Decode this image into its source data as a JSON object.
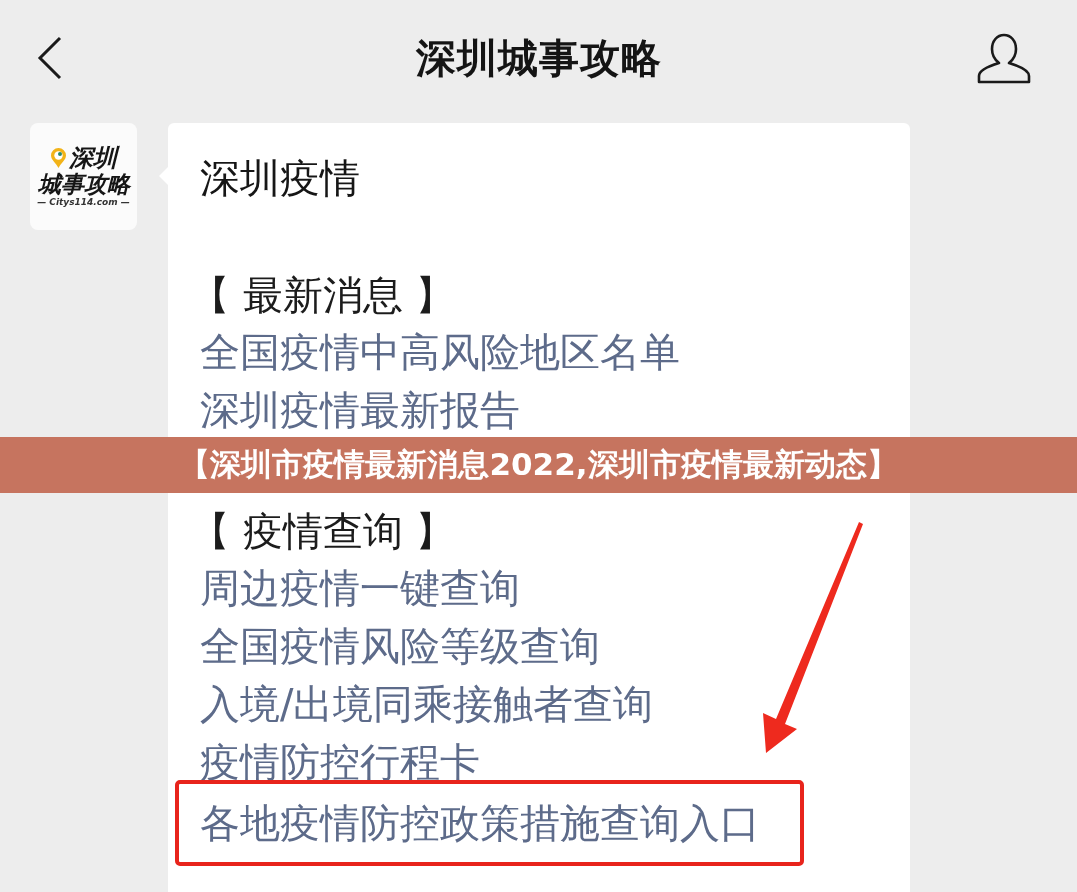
{
  "nav_bar": {
    "title": "深圳城事攻略"
  },
  "chat": {
    "sender_logo": {
      "line_1": "深圳",
      "line_2": "城事攻略",
      "site": "— Citys114.com —"
    },
    "message": {
      "heading": "深圳疫情",
      "sections": [
        {
          "title": "【 最新消息 】",
          "links": [
            {
              "text": "全国疫情中高风险地区名单",
              "highlighted": false
            },
            {
              "text": "深圳疫情最新报告",
              "highlighted": false
            }
          ]
        },
        {
          "title": "【 疫情查询 】",
          "links": [
            {
              "text": "周边疫情一键查询",
              "highlighted": false
            },
            {
              "text": "全国疫情风险等级查询",
              "highlighted": false
            },
            {
              "text": "入境/出境同乘接触者查询",
              "highlighted": false
            },
            {
              "text": "疫情防控行程卡",
              "highlighted": false
            },
            {
              "text": "各地疫情防控政策措施查询入口",
              "highlighted": true
            }
          ]
        }
      ]
    }
  },
  "banner": {
    "text": "【深圳市疫情最新消息2022,深圳市疫情最新动态】"
  }
}
